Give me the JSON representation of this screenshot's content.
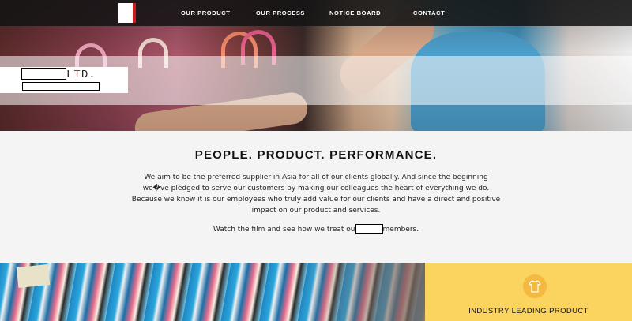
{
  "nav": {
    "items": [
      {
        "label": "OUR PRODUCT"
      },
      {
        "label": "OUR PROCESS"
      },
      {
        "label": "NOTICE BOARD"
      },
      {
        "label": "CONTACT"
      }
    ]
  },
  "brand": {
    "suffix_plain": "L",
    "suffix_accent": "T",
    "suffix_rest": "D."
  },
  "mission": {
    "title": "PEOPLE. PRODUCT. PERFORMANCE.",
    "lines": [
      "We aim to be the preferred supplier in Asia for all of our clients globally. And since the beginning",
      "we�ve pledged to serve our customers by making our colleagues the heart of everything we do.",
      "Because we know it is our employees who truly add value for our clients and have a direct and positive",
      "impact on our product and services."
    ],
    "film_before": "Watch the film and see how we treat ou",
    "film_after": "members."
  },
  "feature": {
    "icon": "shirt-icon",
    "label": "INDUSTRY LEADING PRODUCT"
  },
  "colors": {
    "accent": "#d01a1a",
    "feature_bg": "#fbd460",
    "nav_bg": "#141414"
  }
}
